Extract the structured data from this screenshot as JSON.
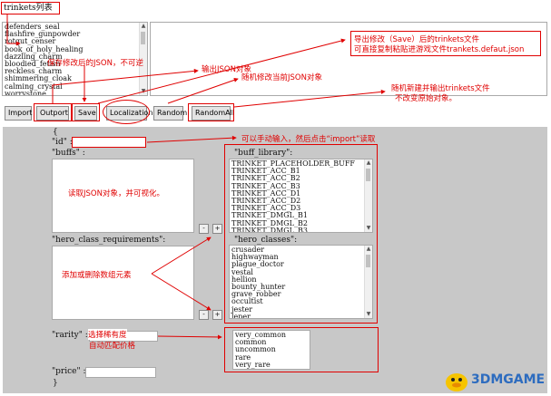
{
  "title": "trinkets列表",
  "trinket_list": [
    "defenders_seal",
    "flashfire_gunpowder",
    "rotgut_censer",
    "book_of_holy_healing",
    "dazzling_charm",
    "bloodied_fetish",
    "reckless_charm",
    "shimmering_cloak",
    "calming_crystal",
    "worrystone"
  ],
  "toolbar": {
    "import": "Import",
    "outport": "Outport",
    "save": "Save",
    "localization": "Localization",
    "random": "Random",
    "random_all": "RandomAll"
  },
  "notes": {
    "save_note": "保存修改后的JSON，不可逆",
    "outport_note": "输出JSON对象",
    "random_note": "随机修改当前JSON对象",
    "export_note_line1": "导出修改（Save）后的trinkets文件",
    "export_note_line2": "可直接复制粘贴进游戏文件trankets.defaut.json",
    "randomall_note_line1": "随机新建并输出trinkets文件",
    "randomall_note_line2": "不改变原始对象。",
    "id_note": "可以手动输入，然后点击“import”读取",
    "buffs_note": "读取JSON对象，并可视化。",
    "array_note": "添加或删除数组元素",
    "rarity_note_line1": "选择稀有度",
    "rarity_note_line2": "自动匹配价格"
  },
  "editor": {
    "open_brace": "{",
    "close_brace": "}",
    "id_label": "\"id\" :",
    "buffs_label": "\"buffs\" :",
    "hero_class_req_label": "\"hero_class_requirements\":",
    "rarity_label": "\"rarity\" :",
    "price_label": "\"price\" :",
    "buff_library_label": "\"buff_library\":",
    "hero_classes_label": "\"hero_classes\":",
    "minus": "-",
    "plus": "+"
  },
  "buff_library": [
    "TRINKET_PLACEHOLDER_BUFF",
    "TRINKET_ACC_B1",
    "TRINKET_ACC_B2",
    "TRINKET_ACC_B3",
    "TRINKET_ACC_D1",
    "TRINKET_ACC_D2",
    "TRINKET_ACC_D3",
    "TRINKET_DMGL_B1",
    "TRINKET_DMGL_B2",
    "TRINKET_DMGL_B3"
  ],
  "hero_classes": [
    "crusader",
    "highwayman",
    "plague_doctor",
    "vestal",
    "hellion",
    "bounty_hunter",
    "grave_robber",
    "occultist",
    "jester",
    "leper"
  ],
  "rarities": [
    "very_common",
    "common",
    "uncommon",
    "rare",
    "very_rare"
  ],
  "watermark": "3DMGAME"
}
